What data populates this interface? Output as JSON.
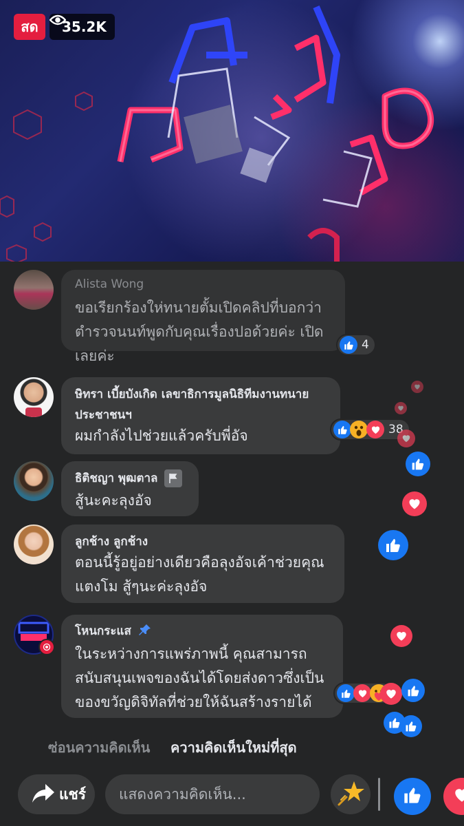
{
  "video": {
    "live_label": "สด",
    "viewer_count": "35.2K"
  },
  "comments": [
    {
      "name": "Alista Wong",
      "lines": [
        "ขอเรียกร้องให่ทนายตั้มเปิดคลิปที่บอกว่า",
        "ตำรวจนนท์พูดกับคุณเรื่องปอด้วยค่ะ เปิด",
        "เลยค่ะ"
      ],
      "reaction_count": "4",
      "reactions": [
        "like"
      ]
    },
    {
      "name_lines": [
        "ษิทรา เบี้ยบังเกิด เลขาธิการมูลนิธิทีมงานทนาย",
        "ประชาชนฯ"
      ],
      "lines": [
        "ผมกำลังไปช่วยแล้วครับพี่อัจ"
      ],
      "reaction_count": "38",
      "reactions": [
        "like",
        "wow",
        "heart"
      ]
    },
    {
      "name": "ธิติชญา พุฒตาล",
      "lines": [
        "สู้นะคะลุงอัจ"
      ]
    },
    {
      "name": "ลูกช้าง ลูกช้าง",
      "lines": [
        "ตอนนี้รู้อยู่อย่างเดียวคือลุงอัจเค้าช่วยคุณ",
        "แตงโม  สู้ๆนะค่ะลุงอัจ"
      ]
    },
    {
      "name": "โหนกระแส",
      "lines": [
        "ในระหว่างการแพร่ภาพนี้ คุณสามารถ",
        "สนับสนุนเพจของฉันได้โดยส่งดาวซึ่งเป็น",
        "ของขวัญดิจิทัลที่ช่วยให้ฉันสร้างรายได้"
      ],
      "reactions": [
        "like",
        "heart",
        "care"
      ]
    }
  ],
  "sort": {
    "hide_label": "ซ่อนความคิดเห็น",
    "newest_label": "ความคิดเห็นใหม่ที่สุด"
  },
  "bottom_bar": {
    "share_label": "แชร์",
    "comment_placeholder": "แสดงความคิดเห็น..."
  },
  "colors": {
    "live_red": "#e41e3f",
    "like_blue": "#1877f2",
    "heart_red": "#f33e58",
    "bubble": "#3a3b3c",
    "background": "#242526"
  },
  "icons": {
    "viewer": "eye-icon",
    "share": "share-arrow-icon",
    "stars": "star-icon",
    "like": "thumbs-up-icon",
    "love": "heart-icon",
    "pin": "pin-icon",
    "flag": "flag-icon"
  }
}
